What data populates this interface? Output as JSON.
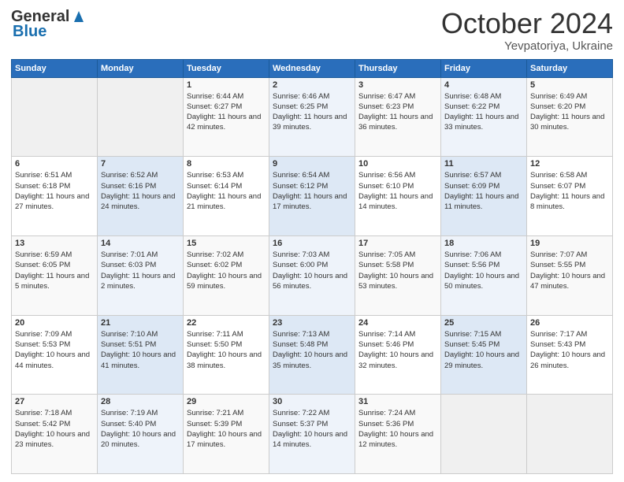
{
  "header": {
    "logo_general": "General",
    "logo_blue": "Blue",
    "title": "October 2024",
    "location": "Yevpatoriya, Ukraine"
  },
  "days_of_week": [
    "Sunday",
    "Monday",
    "Tuesday",
    "Wednesday",
    "Thursday",
    "Friday",
    "Saturday"
  ],
  "weeks": [
    [
      {
        "day": "",
        "sunrise": "",
        "sunset": "",
        "daylight": ""
      },
      {
        "day": "",
        "sunrise": "",
        "sunset": "",
        "daylight": ""
      },
      {
        "day": "1",
        "sunrise": "Sunrise: 6:44 AM",
        "sunset": "Sunset: 6:27 PM",
        "daylight": "Daylight: 11 hours and 42 minutes."
      },
      {
        "day": "2",
        "sunrise": "Sunrise: 6:46 AM",
        "sunset": "Sunset: 6:25 PM",
        "daylight": "Daylight: 11 hours and 39 minutes."
      },
      {
        "day": "3",
        "sunrise": "Sunrise: 6:47 AM",
        "sunset": "Sunset: 6:23 PM",
        "daylight": "Daylight: 11 hours and 36 minutes."
      },
      {
        "day": "4",
        "sunrise": "Sunrise: 6:48 AM",
        "sunset": "Sunset: 6:22 PM",
        "daylight": "Daylight: 11 hours and 33 minutes."
      },
      {
        "day": "5",
        "sunrise": "Sunrise: 6:49 AM",
        "sunset": "Sunset: 6:20 PM",
        "daylight": "Daylight: 11 hours and 30 minutes."
      }
    ],
    [
      {
        "day": "6",
        "sunrise": "Sunrise: 6:51 AM",
        "sunset": "Sunset: 6:18 PM",
        "daylight": "Daylight: 11 hours and 27 minutes."
      },
      {
        "day": "7",
        "sunrise": "Sunrise: 6:52 AM",
        "sunset": "Sunset: 6:16 PM",
        "daylight": "Daylight: 11 hours and 24 minutes."
      },
      {
        "day": "8",
        "sunrise": "Sunrise: 6:53 AM",
        "sunset": "Sunset: 6:14 PM",
        "daylight": "Daylight: 11 hours and 21 minutes."
      },
      {
        "day": "9",
        "sunrise": "Sunrise: 6:54 AM",
        "sunset": "Sunset: 6:12 PM",
        "daylight": "Daylight: 11 hours and 17 minutes."
      },
      {
        "day": "10",
        "sunrise": "Sunrise: 6:56 AM",
        "sunset": "Sunset: 6:10 PM",
        "daylight": "Daylight: 11 hours and 14 minutes."
      },
      {
        "day": "11",
        "sunrise": "Sunrise: 6:57 AM",
        "sunset": "Sunset: 6:09 PM",
        "daylight": "Daylight: 11 hours and 11 minutes."
      },
      {
        "day": "12",
        "sunrise": "Sunrise: 6:58 AM",
        "sunset": "Sunset: 6:07 PM",
        "daylight": "Daylight: 11 hours and 8 minutes."
      }
    ],
    [
      {
        "day": "13",
        "sunrise": "Sunrise: 6:59 AM",
        "sunset": "Sunset: 6:05 PM",
        "daylight": "Daylight: 11 hours and 5 minutes."
      },
      {
        "day": "14",
        "sunrise": "Sunrise: 7:01 AM",
        "sunset": "Sunset: 6:03 PM",
        "daylight": "Daylight: 11 hours and 2 minutes."
      },
      {
        "day": "15",
        "sunrise": "Sunrise: 7:02 AM",
        "sunset": "Sunset: 6:02 PM",
        "daylight": "Daylight: 10 hours and 59 minutes."
      },
      {
        "day": "16",
        "sunrise": "Sunrise: 7:03 AM",
        "sunset": "Sunset: 6:00 PM",
        "daylight": "Daylight: 10 hours and 56 minutes."
      },
      {
        "day": "17",
        "sunrise": "Sunrise: 7:05 AM",
        "sunset": "Sunset: 5:58 PM",
        "daylight": "Daylight: 10 hours and 53 minutes."
      },
      {
        "day": "18",
        "sunrise": "Sunrise: 7:06 AM",
        "sunset": "Sunset: 5:56 PM",
        "daylight": "Daylight: 10 hours and 50 minutes."
      },
      {
        "day": "19",
        "sunrise": "Sunrise: 7:07 AM",
        "sunset": "Sunset: 5:55 PM",
        "daylight": "Daylight: 10 hours and 47 minutes."
      }
    ],
    [
      {
        "day": "20",
        "sunrise": "Sunrise: 7:09 AM",
        "sunset": "Sunset: 5:53 PM",
        "daylight": "Daylight: 10 hours and 44 minutes."
      },
      {
        "day": "21",
        "sunrise": "Sunrise: 7:10 AM",
        "sunset": "Sunset: 5:51 PM",
        "daylight": "Daylight: 10 hours and 41 minutes."
      },
      {
        "day": "22",
        "sunrise": "Sunrise: 7:11 AM",
        "sunset": "Sunset: 5:50 PM",
        "daylight": "Daylight: 10 hours and 38 minutes."
      },
      {
        "day": "23",
        "sunrise": "Sunrise: 7:13 AM",
        "sunset": "Sunset: 5:48 PM",
        "daylight": "Daylight: 10 hours and 35 minutes."
      },
      {
        "day": "24",
        "sunrise": "Sunrise: 7:14 AM",
        "sunset": "Sunset: 5:46 PM",
        "daylight": "Daylight: 10 hours and 32 minutes."
      },
      {
        "day": "25",
        "sunrise": "Sunrise: 7:15 AM",
        "sunset": "Sunset: 5:45 PM",
        "daylight": "Daylight: 10 hours and 29 minutes."
      },
      {
        "day": "26",
        "sunrise": "Sunrise: 7:17 AM",
        "sunset": "Sunset: 5:43 PM",
        "daylight": "Daylight: 10 hours and 26 minutes."
      }
    ],
    [
      {
        "day": "27",
        "sunrise": "Sunrise: 7:18 AM",
        "sunset": "Sunset: 5:42 PM",
        "daylight": "Daylight: 10 hours and 23 minutes."
      },
      {
        "day": "28",
        "sunrise": "Sunrise: 7:19 AM",
        "sunset": "Sunset: 5:40 PM",
        "daylight": "Daylight: 10 hours and 20 minutes."
      },
      {
        "day": "29",
        "sunrise": "Sunrise: 7:21 AM",
        "sunset": "Sunset: 5:39 PM",
        "daylight": "Daylight: 10 hours and 17 minutes."
      },
      {
        "day": "30",
        "sunrise": "Sunrise: 7:22 AM",
        "sunset": "Sunset: 5:37 PM",
        "daylight": "Daylight: 10 hours and 14 minutes."
      },
      {
        "day": "31",
        "sunrise": "Sunrise: 7:24 AM",
        "sunset": "Sunset: 5:36 PM",
        "daylight": "Daylight: 10 hours and 12 minutes."
      },
      {
        "day": "",
        "sunrise": "",
        "sunset": "",
        "daylight": ""
      },
      {
        "day": "",
        "sunrise": "",
        "sunset": "",
        "daylight": ""
      }
    ]
  ]
}
